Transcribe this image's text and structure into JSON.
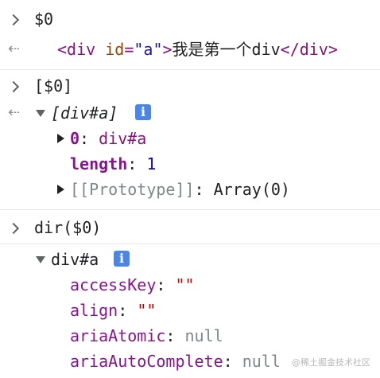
{
  "entries": {
    "e1": {
      "input": "$0",
      "output": {
        "open_lt": "<",
        "tag": "div",
        "attr_name": "id",
        "attr_eq": "=",
        "attr_value": "\"a\"",
        "open_gt": ">",
        "text": "我是第一个div",
        "close_lt": "</",
        "close_tag": "div",
        "close_gt": ">"
      }
    },
    "e2": {
      "input": "[$0]",
      "array_label": "[div#a]",
      "info_icon_label": "i",
      "item_index": "0",
      "item_colon": ":",
      "item_value": "div#a",
      "length_key": "length",
      "length_colon": ":",
      "length_value": "1",
      "proto_key": "[[Prototype]]",
      "proto_colon": ":",
      "proto_value": "Array(0)"
    },
    "e3": {
      "input": "dir($0)",
      "object_label": "div#a",
      "info_icon_label": "i",
      "properties": [
        {
          "key": "accessKey",
          "colon": ":",
          "value": "\"\"",
          "kind": "string"
        },
        {
          "key": "align",
          "colon": ":",
          "value": "\"\"",
          "kind": "string"
        },
        {
          "key": "ariaAtomic",
          "colon": ":",
          "value": "null",
          "kind": "null"
        },
        {
          "key": "ariaAutoComplete",
          "colon": ":",
          "value": "null",
          "kind": "null"
        }
      ]
    }
  },
  "watermark": "@稀土掘金技术社区",
  "colors": {
    "tag": "#881280",
    "attr_name": "#994500",
    "attr_value": "#1a1aa6",
    "property_key": "#881391",
    "number": "#1c00cf",
    "string": "#c80000",
    "null": "#80868b",
    "info_badge": "#4a86e8"
  }
}
